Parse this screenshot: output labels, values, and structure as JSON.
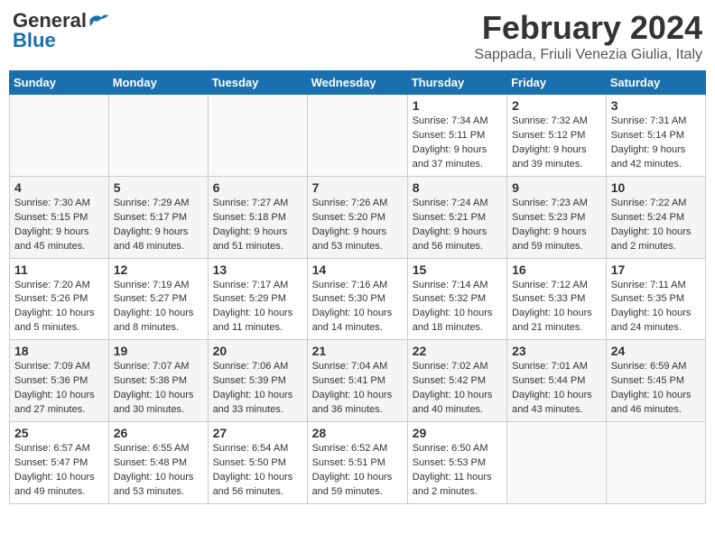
{
  "header": {
    "logo_line1": "General",
    "logo_line2": "Blue",
    "month_year": "February 2024",
    "location": "Sappada, Friuli Venezia Giulia, Italy"
  },
  "days_of_week": [
    "Sunday",
    "Monday",
    "Tuesday",
    "Wednesday",
    "Thursday",
    "Friday",
    "Saturday"
  ],
  "weeks": [
    [
      {
        "day": "",
        "info": ""
      },
      {
        "day": "",
        "info": ""
      },
      {
        "day": "",
        "info": ""
      },
      {
        "day": "",
        "info": ""
      },
      {
        "day": "1",
        "info": "Sunrise: 7:34 AM\nSunset: 5:11 PM\nDaylight: 9 hours\nand 37 minutes."
      },
      {
        "day": "2",
        "info": "Sunrise: 7:32 AM\nSunset: 5:12 PM\nDaylight: 9 hours\nand 39 minutes."
      },
      {
        "day": "3",
        "info": "Sunrise: 7:31 AM\nSunset: 5:14 PM\nDaylight: 9 hours\nand 42 minutes."
      }
    ],
    [
      {
        "day": "4",
        "info": "Sunrise: 7:30 AM\nSunset: 5:15 PM\nDaylight: 9 hours\nand 45 minutes."
      },
      {
        "day": "5",
        "info": "Sunrise: 7:29 AM\nSunset: 5:17 PM\nDaylight: 9 hours\nand 48 minutes."
      },
      {
        "day": "6",
        "info": "Sunrise: 7:27 AM\nSunset: 5:18 PM\nDaylight: 9 hours\nand 51 minutes."
      },
      {
        "day": "7",
        "info": "Sunrise: 7:26 AM\nSunset: 5:20 PM\nDaylight: 9 hours\nand 53 minutes."
      },
      {
        "day": "8",
        "info": "Sunrise: 7:24 AM\nSunset: 5:21 PM\nDaylight: 9 hours\nand 56 minutes."
      },
      {
        "day": "9",
        "info": "Sunrise: 7:23 AM\nSunset: 5:23 PM\nDaylight: 9 hours\nand 59 minutes."
      },
      {
        "day": "10",
        "info": "Sunrise: 7:22 AM\nSunset: 5:24 PM\nDaylight: 10 hours\nand 2 minutes."
      }
    ],
    [
      {
        "day": "11",
        "info": "Sunrise: 7:20 AM\nSunset: 5:26 PM\nDaylight: 10 hours\nand 5 minutes."
      },
      {
        "day": "12",
        "info": "Sunrise: 7:19 AM\nSunset: 5:27 PM\nDaylight: 10 hours\nand 8 minutes."
      },
      {
        "day": "13",
        "info": "Sunrise: 7:17 AM\nSunset: 5:29 PM\nDaylight: 10 hours\nand 11 minutes."
      },
      {
        "day": "14",
        "info": "Sunrise: 7:16 AM\nSunset: 5:30 PM\nDaylight: 10 hours\nand 14 minutes."
      },
      {
        "day": "15",
        "info": "Sunrise: 7:14 AM\nSunset: 5:32 PM\nDaylight: 10 hours\nand 18 minutes."
      },
      {
        "day": "16",
        "info": "Sunrise: 7:12 AM\nSunset: 5:33 PM\nDaylight: 10 hours\nand 21 minutes."
      },
      {
        "day": "17",
        "info": "Sunrise: 7:11 AM\nSunset: 5:35 PM\nDaylight: 10 hours\nand 24 minutes."
      }
    ],
    [
      {
        "day": "18",
        "info": "Sunrise: 7:09 AM\nSunset: 5:36 PM\nDaylight: 10 hours\nand 27 minutes."
      },
      {
        "day": "19",
        "info": "Sunrise: 7:07 AM\nSunset: 5:38 PM\nDaylight: 10 hours\nand 30 minutes."
      },
      {
        "day": "20",
        "info": "Sunrise: 7:06 AM\nSunset: 5:39 PM\nDaylight: 10 hours\nand 33 minutes."
      },
      {
        "day": "21",
        "info": "Sunrise: 7:04 AM\nSunset: 5:41 PM\nDaylight: 10 hours\nand 36 minutes."
      },
      {
        "day": "22",
        "info": "Sunrise: 7:02 AM\nSunset: 5:42 PM\nDaylight: 10 hours\nand 40 minutes."
      },
      {
        "day": "23",
        "info": "Sunrise: 7:01 AM\nSunset: 5:44 PM\nDaylight: 10 hours\nand 43 minutes."
      },
      {
        "day": "24",
        "info": "Sunrise: 6:59 AM\nSunset: 5:45 PM\nDaylight: 10 hours\nand 46 minutes."
      }
    ],
    [
      {
        "day": "25",
        "info": "Sunrise: 6:57 AM\nSunset: 5:47 PM\nDaylight: 10 hours\nand 49 minutes."
      },
      {
        "day": "26",
        "info": "Sunrise: 6:55 AM\nSunset: 5:48 PM\nDaylight: 10 hours\nand 53 minutes."
      },
      {
        "day": "27",
        "info": "Sunrise: 6:54 AM\nSunset: 5:50 PM\nDaylight: 10 hours\nand 56 minutes."
      },
      {
        "day": "28",
        "info": "Sunrise: 6:52 AM\nSunset: 5:51 PM\nDaylight: 10 hours\nand 59 minutes."
      },
      {
        "day": "29",
        "info": "Sunrise: 6:50 AM\nSunset: 5:53 PM\nDaylight: 11 hours\nand 2 minutes."
      },
      {
        "day": "",
        "info": ""
      },
      {
        "day": "",
        "info": ""
      }
    ]
  ],
  "accent_color": "#1a6fae"
}
